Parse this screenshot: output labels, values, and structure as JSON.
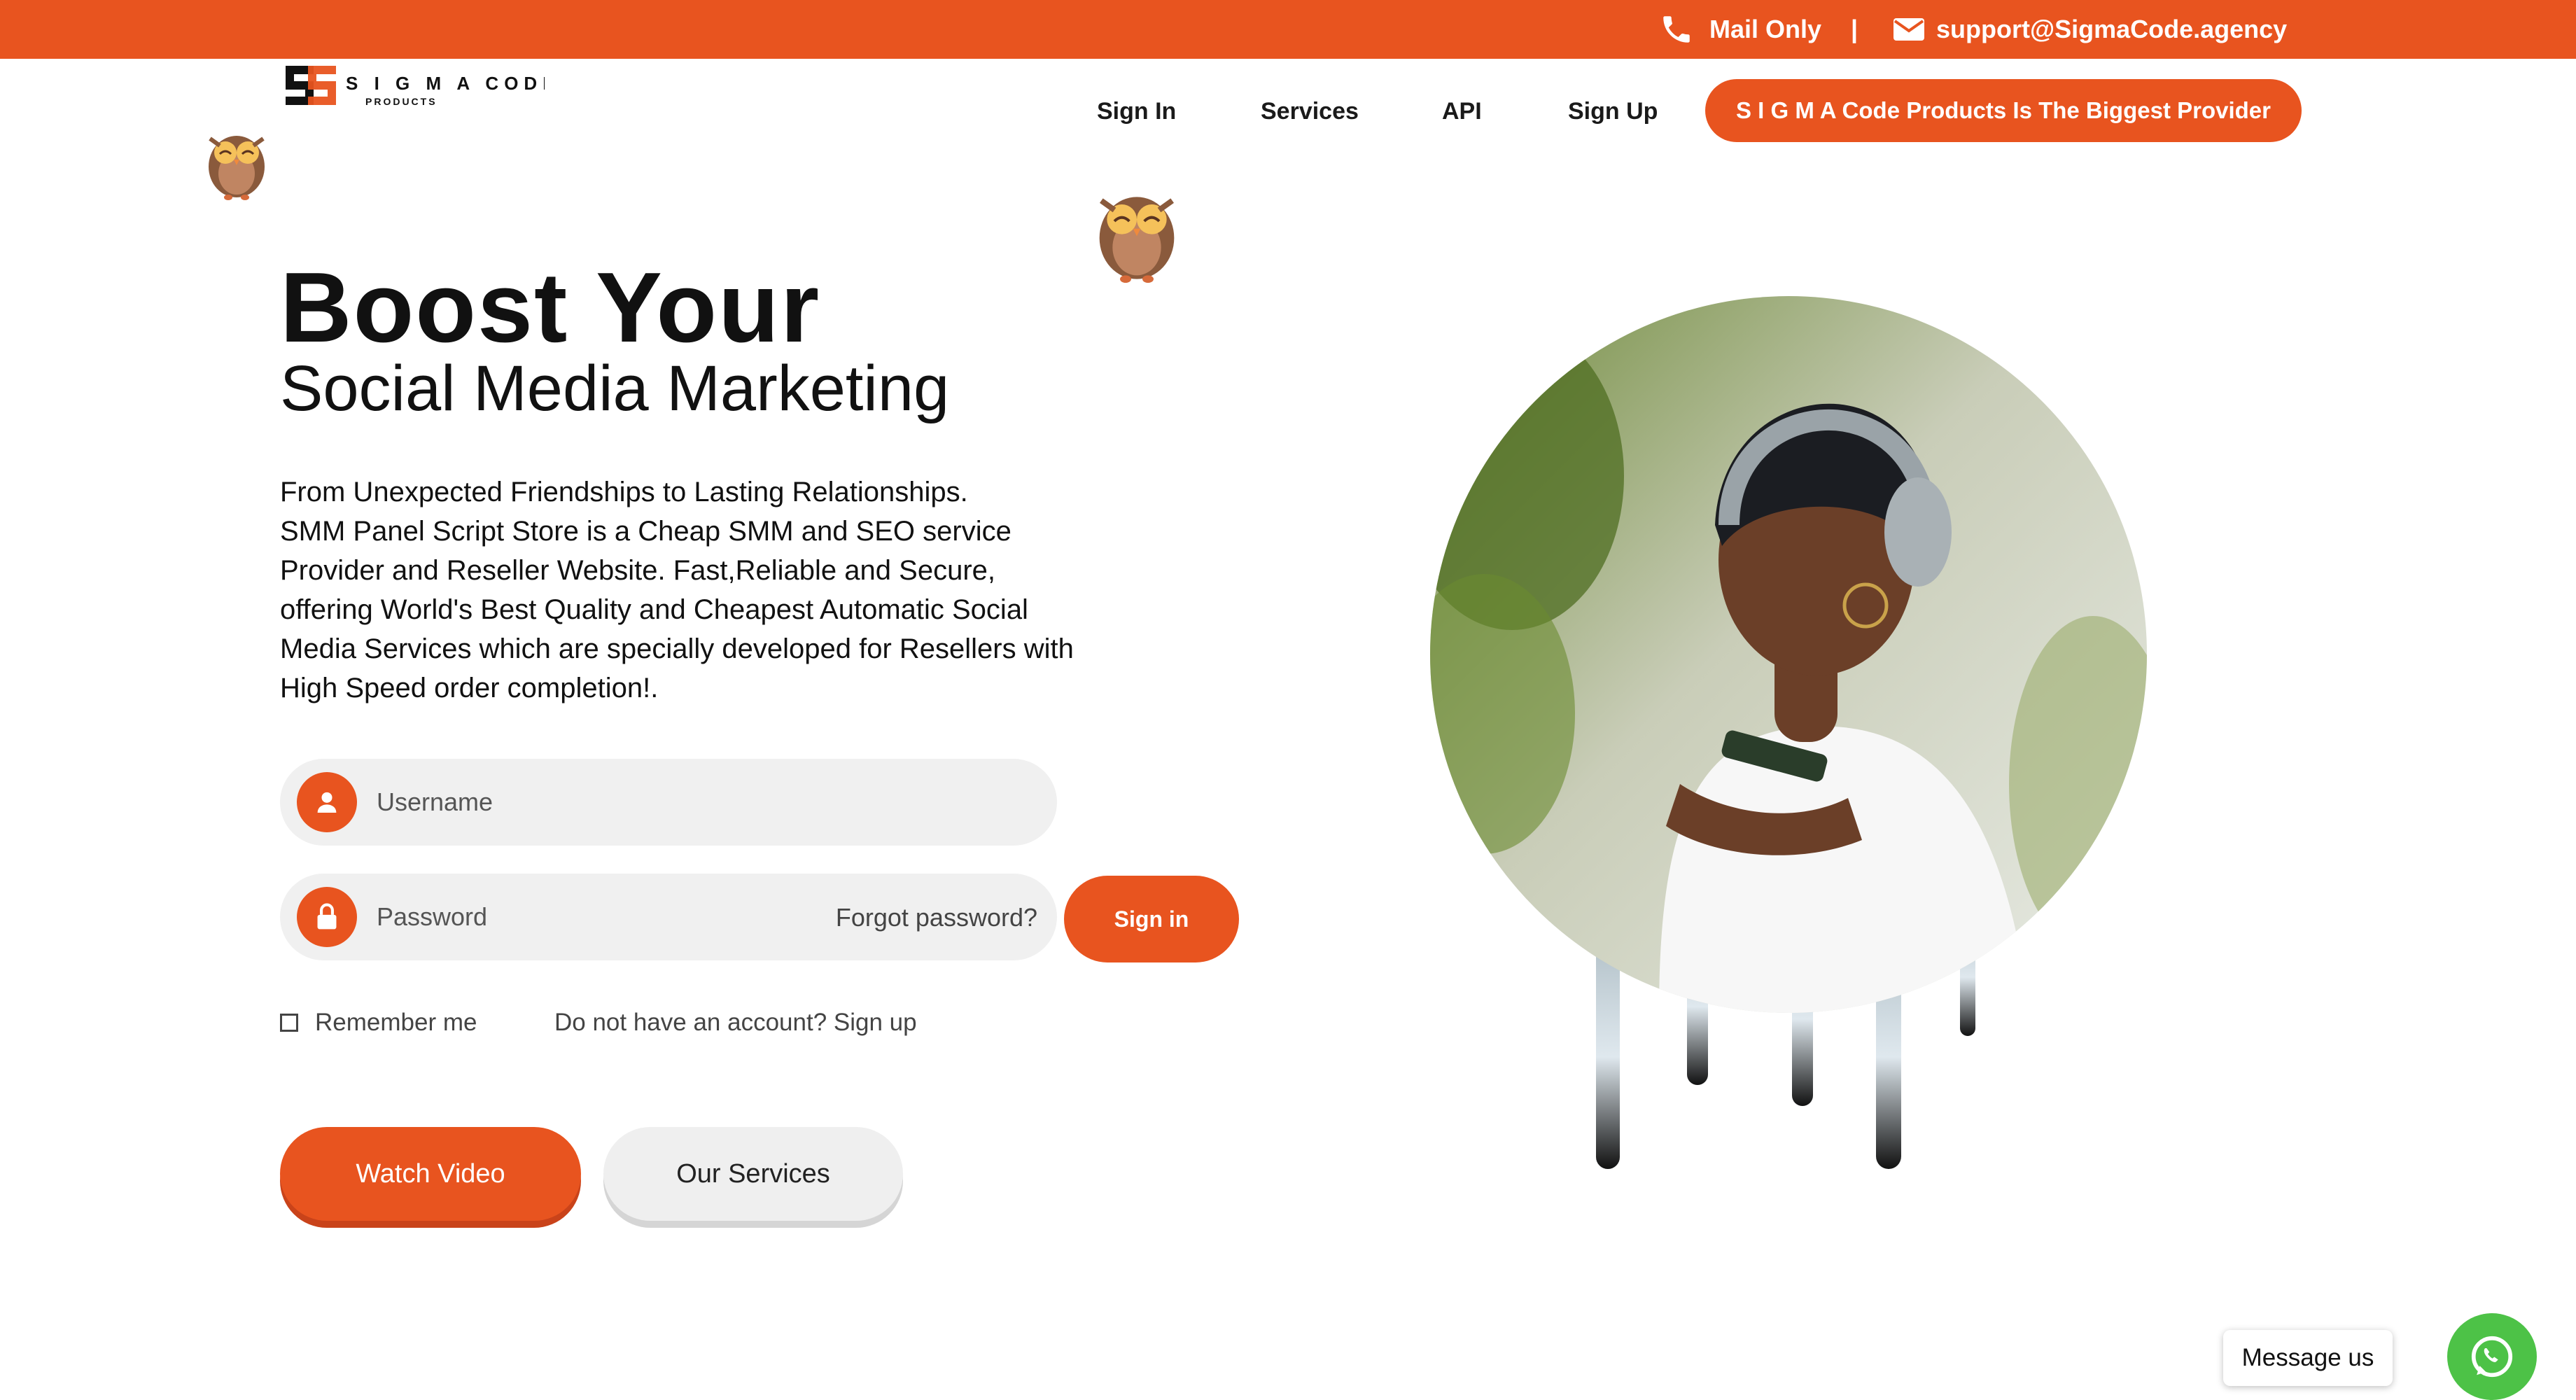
{
  "topbar": {
    "phone_label": "Mail Only",
    "separator": "|",
    "email": "support@SigmaCode.agency"
  },
  "logo": {
    "text_main": "S I G M A  CODE",
    "text_sub": "PRODUCTS"
  },
  "nav": {
    "items": [
      "Sign In",
      "Services",
      "API",
      "Sign Up"
    ],
    "cta": "S I G M A Code Products Is The Biggest Provider"
  },
  "hero": {
    "title": "Boost Your",
    "subtitle": "Social Media Marketing",
    "description": "From Unexpected Friendships to Lasting Relationships.\n SMM Panel Script Store is a Cheap SMM and SEO service\nProvider and Reseller Website. Fast,Reliable and Secure,\noffering World's Best Quality and Cheapest Automatic Social\nMedia Services which are specially developed for Resellers with\nHigh Speed order completion!."
  },
  "login": {
    "username_placeholder": "Username",
    "password_placeholder": "Password",
    "forgot": "Forgot password?",
    "signin": "Sign in",
    "remember": "Remember me",
    "signup_prompt": "Do not have an account? Sign up"
  },
  "actions": {
    "watch_video": "Watch Video",
    "our_services": "Our Services"
  },
  "chat": {
    "message_us": "Message us"
  },
  "colors": {
    "accent": "#e8541f",
    "whatsapp": "#4dc247"
  },
  "icons": [
    "phone-icon",
    "mail-icon",
    "user-icon",
    "lock-icon",
    "whatsapp-icon",
    "owl-mascot"
  ]
}
